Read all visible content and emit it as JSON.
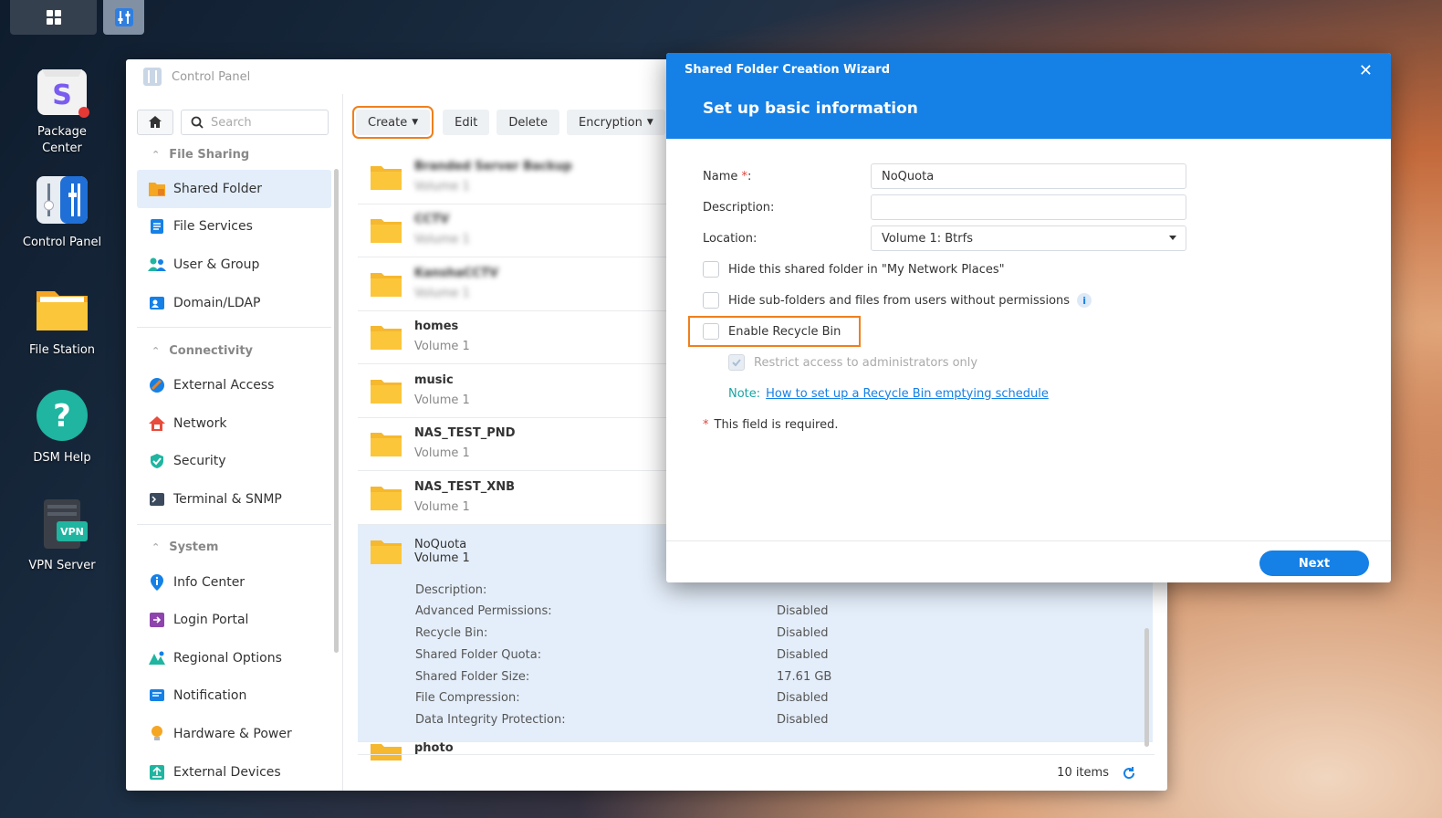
{
  "desktop": {
    "icons": [
      {
        "label_line1": "Package",
        "label_line2": "Center",
        "icon": "package-center-icon"
      },
      {
        "label": "Control Panel",
        "icon": "control-panel-icon"
      },
      {
        "label": "File Station",
        "icon": "file-station-icon"
      },
      {
        "label": "DSM Help",
        "icon": "help-icon"
      },
      {
        "label": "VPN Server",
        "icon": "vpn-server-icon",
        "badge": "VPN"
      }
    ]
  },
  "control_panel": {
    "title": "Control Panel",
    "search_placeholder": "Search",
    "sidebar": {
      "groups": [
        {
          "label": "File Sharing",
          "items": [
            "Shared Folder",
            "File Services",
            "User & Group",
            "Domain/LDAP"
          ]
        },
        {
          "label": "Connectivity",
          "items": [
            "External Access",
            "Network",
            "Security",
            "Terminal & SNMP"
          ]
        },
        {
          "label": "System",
          "items": [
            "Info Center",
            "Login Portal",
            "Regional Options",
            "Notification",
            "Hardware & Power",
            "External Devices"
          ]
        }
      ],
      "active_item": "Shared Folder"
    },
    "toolbar": {
      "create": "Create",
      "edit": "Edit",
      "delete": "Delete",
      "encryption": "Encryption"
    },
    "folders": [
      {
        "name": "Branded Server Backup",
        "volume": "Volume 1",
        "blurred": true
      },
      {
        "name": "CCTV",
        "volume": "Volume 1",
        "blurred": true
      },
      {
        "name": "KanshaCCTV",
        "volume": "Volume 1",
        "blurred": true
      },
      {
        "name": "homes",
        "volume": "Volume 1"
      },
      {
        "name": "music",
        "volume": "Volume 1"
      },
      {
        "name": "NAS_TEST_PND",
        "volume": "Volume 1"
      },
      {
        "name": "NAS_TEST_XNB",
        "volume": "Volume 1"
      }
    ],
    "selected_folder": {
      "name": "NoQuota",
      "volume": "Volume 1",
      "details": [
        {
          "key": "Description:",
          "value": ""
        },
        {
          "key": "Advanced Permissions:",
          "value": "Disabled"
        },
        {
          "key": "Recycle Bin:",
          "value": "Disabled"
        },
        {
          "key": "Shared Folder Quota:",
          "value": "Disabled"
        },
        {
          "key": "Shared Folder Size:",
          "value": "17.61 GB"
        },
        {
          "key": "File Compression:",
          "value": "Disabled"
        },
        {
          "key": "Data Integrity Protection:",
          "value": "Disabled"
        }
      ]
    },
    "partial_folder": "photo",
    "footer_count": "10 items"
  },
  "wizard": {
    "title": "Shared Folder Creation Wizard",
    "step_title": "Set up basic information",
    "name_label": "Name",
    "name_req_mark": "*",
    "name_colon": ":",
    "name_value": "NoQuota",
    "description_label": "Description:",
    "description_value": "",
    "location_label": "Location:",
    "location_value": "Volume 1:  Btrfs",
    "hide_network_places": "Hide this shared folder in \"My Network Places\"",
    "hide_subfolders": "Hide sub-folders and files from users without permissions",
    "enable_recycle_bin": "Enable Recycle Bin",
    "restrict_access": "Restrict access to administrators only",
    "note_label": "Note:",
    "note_link": "How to set up a Recycle Bin emptying schedule",
    "required_mark": "*",
    "required_note": "This field is required.",
    "next_button": "Next"
  },
  "colors": {
    "accent": "#1580e6",
    "highlight": "#f07f1c",
    "selected_row": "#e4eefa",
    "folder": "#f9c33c"
  }
}
